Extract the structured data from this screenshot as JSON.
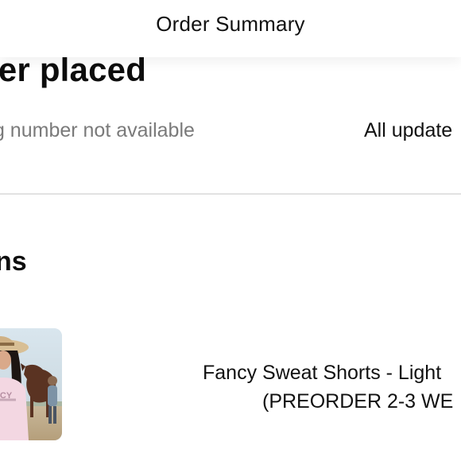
{
  "header": {
    "title": "Order Summary"
  },
  "order_status": {
    "heading": "der placed",
    "tracking_text": "king number not available",
    "updates_link": "All update"
  },
  "items_section": {
    "heading": "ns",
    "items": [
      {
        "name_line1": "Fancy Sweat Shorts - Light",
        "name_line2": "(PREORDER 2-3 WE",
        "image_icon": "product-photo-icon"
      }
    ]
  },
  "colors": {
    "text_primary": "#111111",
    "text_secondary": "#7a7a7a",
    "divider": "#e2e2e2",
    "background": "#ffffff"
  }
}
